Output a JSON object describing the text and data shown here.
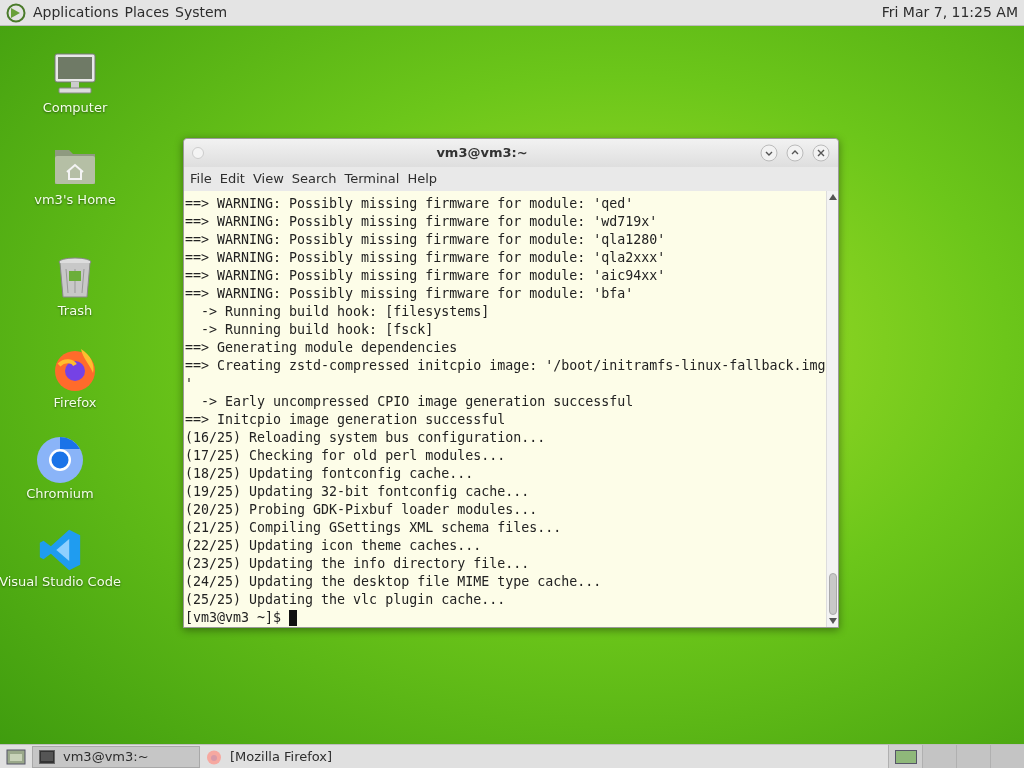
{
  "top_panel": {
    "menus": [
      "Applications",
      "Places",
      "System"
    ],
    "clock": "Fri Mar 7, 11:25 AM"
  },
  "desktop_icons": [
    {
      "kind": "computer",
      "label": "Computer"
    },
    {
      "kind": "home",
      "label": "vm3's Home"
    },
    {
      "kind": "trash",
      "label": "Trash"
    },
    {
      "kind": "firefox",
      "label": "Firefox"
    },
    {
      "kind": "chromium",
      "label": "Chromium"
    },
    {
      "kind": "vscode",
      "label": "Visual Studio Code"
    }
  ],
  "terminal": {
    "title": "vm3@vm3:~",
    "menu": [
      "File",
      "Edit",
      "View",
      "Search",
      "Terminal",
      "Help"
    ],
    "lines": [
      "==> WARNING: Possibly missing firmware for module: 'qed'",
      "==> WARNING: Possibly missing firmware for module: 'wd719x'",
      "==> WARNING: Possibly missing firmware for module: 'qla1280'",
      "==> WARNING: Possibly missing firmware for module: 'qla2xxx'",
      "==> WARNING: Possibly missing firmware for module: 'aic94xx'",
      "==> WARNING: Possibly missing firmware for module: 'bfa'",
      "  -> Running build hook: [filesystems]",
      "  -> Running build hook: [fsck]",
      "==> Generating module dependencies",
      "==> Creating zstd-compressed initcpio image: '/boot/initramfs-linux-fallback.img",
      "'",
      "  -> Early uncompressed CPIO image generation successful",
      "==> Initcpio image generation successful",
      "(16/25) Reloading system bus configuration...",
      "(17/25) Checking for old perl modules...",
      "(18/25) Updating fontconfig cache...",
      "(19/25) Updating 32-bit fontconfig cache...",
      "(20/25) Probing GDK-Pixbuf loader modules...",
      "(21/25) Compiling GSettings XML schema files...",
      "(22/25) Updating icon theme caches...",
      "(23/25) Updating the info directory file...",
      "(24/25) Updating the desktop file MIME type cache...",
      "(25/25) Updating the vlc plugin cache..."
    ],
    "prompt": "[vm3@vm3 ~]$"
  },
  "taskbar": {
    "tasks": [
      {
        "kind": "terminal",
        "label": "vm3@vm3:~",
        "selected": true
      },
      {
        "kind": "firefox",
        "label": "[Mozilla Firefox]",
        "selected": false
      }
    ],
    "workspaces": [
      {
        "selected": true
      },
      {
        "selected": false
      },
      {
        "selected": false
      },
      {
        "selected": false
      }
    ]
  }
}
